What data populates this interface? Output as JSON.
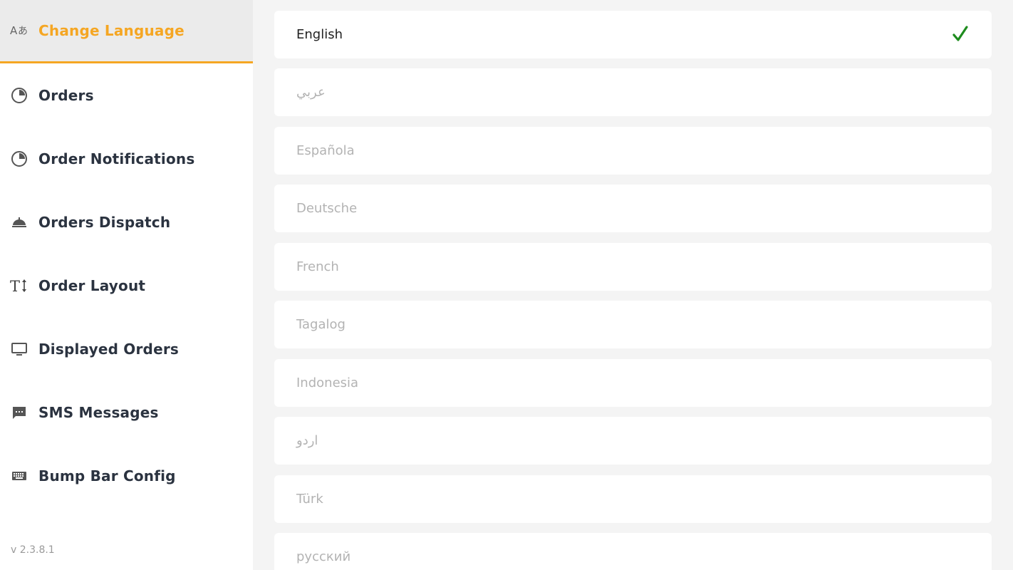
{
  "sidebar": {
    "items": [
      {
        "label": "Change Language",
        "icon": "translate-icon",
        "active": true
      },
      {
        "label": "Orders",
        "icon": "pie-chart-icon"
      },
      {
        "label": "Order Notifications",
        "icon": "pie-chart-icon"
      },
      {
        "label": "Orders Dispatch",
        "icon": "room-service-icon"
      },
      {
        "label": "Order Layout",
        "icon": "text-height-icon"
      },
      {
        "label": "Displayed Orders",
        "icon": "monitor-icon"
      },
      {
        "label": "SMS Messages",
        "icon": "message-icon"
      },
      {
        "label": "Bump Bar Config",
        "icon": "keyboard-icon"
      }
    ],
    "version": "v 2.3.8.1"
  },
  "languages": [
    {
      "label": "English",
      "selected": true
    },
    {
      "label": "عربي"
    },
    {
      "label": "Española"
    },
    {
      "label": "Deutsche"
    },
    {
      "label": "French"
    },
    {
      "label": "Tagalog"
    },
    {
      "label": "Indonesia"
    },
    {
      "label": "اردو"
    },
    {
      "label": "Türk"
    },
    {
      "label": "русский"
    }
  ],
  "colors": {
    "accent": "#f5a623",
    "check": "#1e8c1e",
    "text_dark": "#2b3340",
    "text_muted": "#b3b3b3"
  }
}
